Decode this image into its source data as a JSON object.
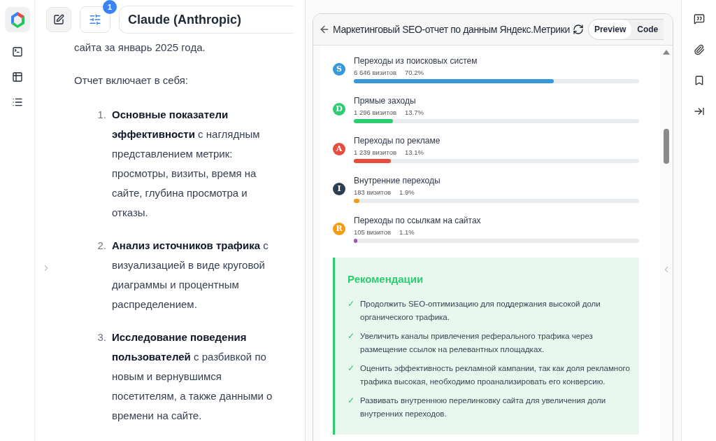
{
  "header": {
    "model": "Claude (Anthropic)",
    "settings_badge": "1"
  },
  "chat": {
    "intro_tail": "сайта за январь 2025 года.",
    "lead": "Отчет включает в себя:",
    "items": [
      {
        "number": "1.",
        "text": "**Основные показатели эффективности** с наглядным представлением метрик: просмотры, визиты, время на сайте, глубина просмотра и отказы."
      },
      {
        "number": "2.",
        "text": "**Анализ источников трафика** с визуализацией в виде круговой диаграммы и процентным распределением."
      },
      {
        "number": "3.",
        "text": "**Исследование поведения пользователей** с разбивкой по новым и вернувшимся посетителям, а также данными о времени на сайте."
      }
    ]
  },
  "artifact": {
    "title": "Маркетинговый SEO-отчет по данным Яндекс.Метрики",
    "tabs": [
      {
        "label": "Preview",
        "selected": true
      },
      {
        "label": "Code",
        "selected": false
      }
    ],
    "sources": [
      {
        "letter": "S",
        "name": "Переходы из поисковых систем",
        "visits": "6 646 визитов",
        "share": "70.2%",
        "color": "#3498db",
        "bar": {
          "level": 0.702,
          "color": "#3498db"
        }
      },
      {
        "letter": "D",
        "name": "Прямые заходы",
        "visits": "1 296 визитов",
        "share": "13.7%",
        "color": "#2ecc71",
        "bar": {
          "level": 0.137,
          "color": "#2ecc71"
        }
      },
      {
        "letter": "A",
        "name": "Переходы по рекламе",
        "visits": "1 239 визитов",
        "share": "13.1%",
        "color": "#e74c3c",
        "bar": {
          "level": 0.131,
          "color": "#e74c3c"
        }
      },
      {
        "letter": "I",
        "name": "Внутренние переходы",
        "visits": "183 визитов",
        "share": "1.9%",
        "color": "#2c3e50",
        "bar": {
          "level": 0.019,
          "color": "#f39c12"
        }
      },
      {
        "letter": "R",
        "name": "Переходы по ссылкам на сайтах",
        "visits": "105 визитов",
        "share": "1.1%",
        "color": "#f39c12",
        "bar": {
          "level": 0.011,
          "color": "#9b59b6"
        }
      }
    ],
    "recommendations": {
      "title": "Рекомендации",
      "items": [
        {
          "mark": "✓",
          "text": "Продолжить SEO-оптимизацию для поддержания высокой доли органического трафика."
        },
        {
          "mark": "✓",
          "text": "Увеличить каналы привлечения реферального трафика через размещение ссылок на релевантных площадках."
        },
        {
          "mark": "✓",
          "text": "Оценить эффективность рекламной кампании, так как доля рекламного трафика высокая, необходимо проанализировать его конверсию."
        },
        {
          "mark": "✓",
          "text": "Развивать внутреннюю перелинковку сайта для увеличения доли внутренних переходов."
        }
      ]
    }
  }
}
